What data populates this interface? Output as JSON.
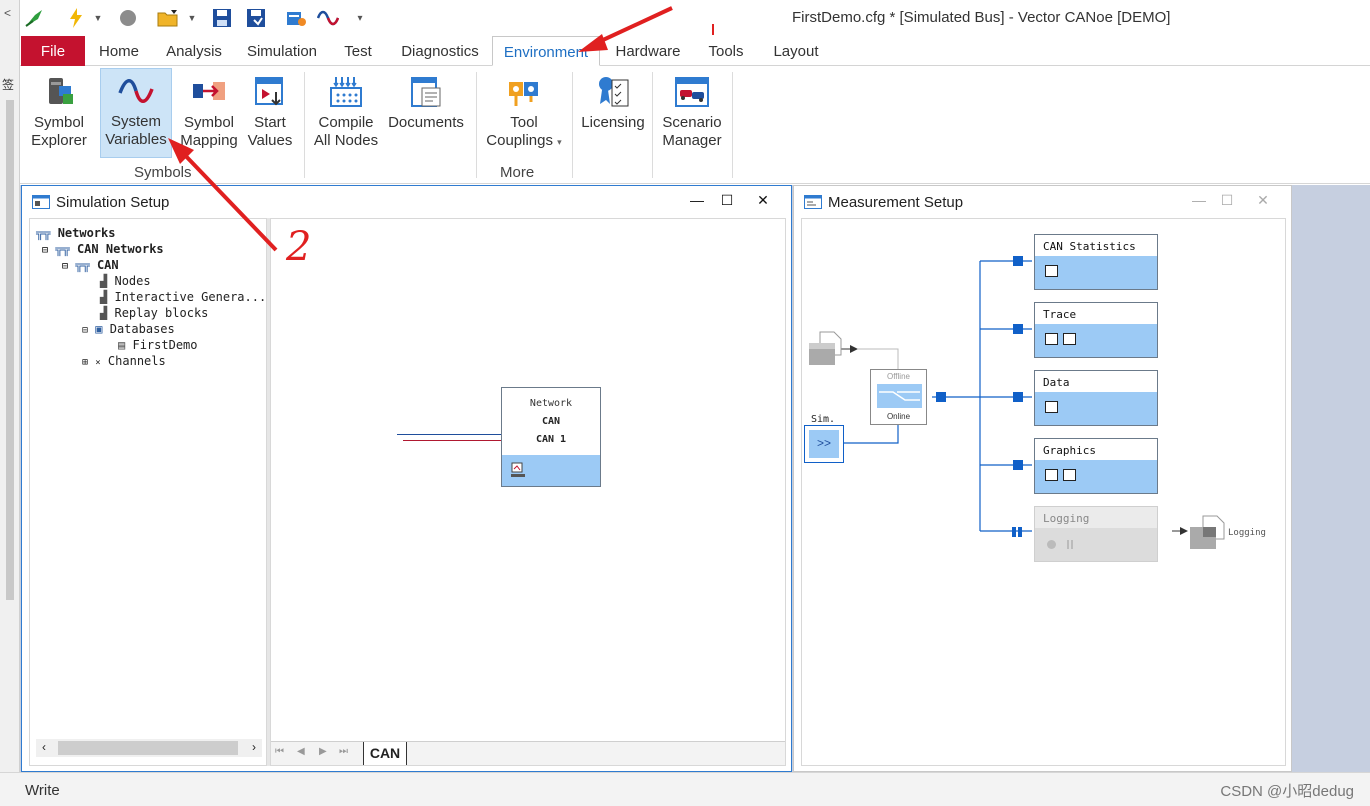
{
  "window": {
    "title": "FirstDemo.cfg * [Simulated Bus] - Vector CANoe [DEMO]"
  },
  "left_strip": {
    "chevron": "<",
    "glyph": "签"
  },
  "ribbon_tabs": [
    {
      "label": "File"
    },
    {
      "label": "Home"
    },
    {
      "label": "Analysis"
    },
    {
      "label": "Simulation"
    },
    {
      "label": "Test"
    },
    {
      "label": "Diagnostics"
    },
    {
      "label": "Environment"
    },
    {
      "label": "Hardware"
    },
    {
      "label": "Tools"
    },
    {
      "label": "Layout"
    }
  ],
  "ribbon": {
    "symbol_explorer": [
      "Symbol",
      "Explorer"
    ],
    "system_variables": [
      "System",
      "Variables"
    ],
    "symbol_mapping": [
      "Symbol",
      "Mapping"
    ],
    "start_values": [
      "Start",
      "Values"
    ],
    "compile_all_nodes": [
      "Compile",
      "All Nodes"
    ],
    "documents": [
      "Documents"
    ],
    "tool_couplings": [
      "Tool",
      "Couplings"
    ],
    "licensing": [
      "Licensing"
    ],
    "scenario_manager": [
      "Scenario",
      "Manager"
    ],
    "groups": {
      "symbols": "Symbols",
      "more": "More"
    }
  },
  "simulation_setup": {
    "title": "Simulation Setup",
    "tree": {
      "networks": "Networks",
      "can_networks": "CAN Networks",
      "can": "CAN",
      "nodes": "Nodes",
      "interactive_generators": "Interactive Genera...",
      "replay_blocks": "Replay blocks",
      "databases": "Databases",
      "firstdemo": "FirstDemo",
      "channels": "Channels"
    },
    "network_block": {
      "line1": "Network",
      "line2": "CAN",
      "line3": "CAN 1"
    },
    "tab": "CAN"
  },
  "measurement_setup": {
    "title": "Measurement Setup",
    "switch": {
      "offline": "Offline",
      "online": "Online"
    },
    "sim_label": "Sim.",
    "sim_glyph": ">>",
    "boxes": [
      {
        "label": "CAN Statistics"
      },
      {
        "label": "Trace"
      },
      {
        "label": "Data"
      },
      {
        "label": "Graphics"
      },
      {
        "label": "Logging"
      }
    ],
    "logging_file": "Logging"
  },
  "annotation": {
    "step2": "2"
  },
  "status": {
    "text": "Write",
    "watermark": "CSDN @小昭dedug"
  },
  "colors": {
    "file_tab": "#c4122f",
    "active_tab_text": "#1e6fc3",
    "window_border": "#2f7bd0",
    "block_fill": "#9ccaf5",
    "connector": "#1060c8",
    "annotation_red": "#e02020"
  }
}
